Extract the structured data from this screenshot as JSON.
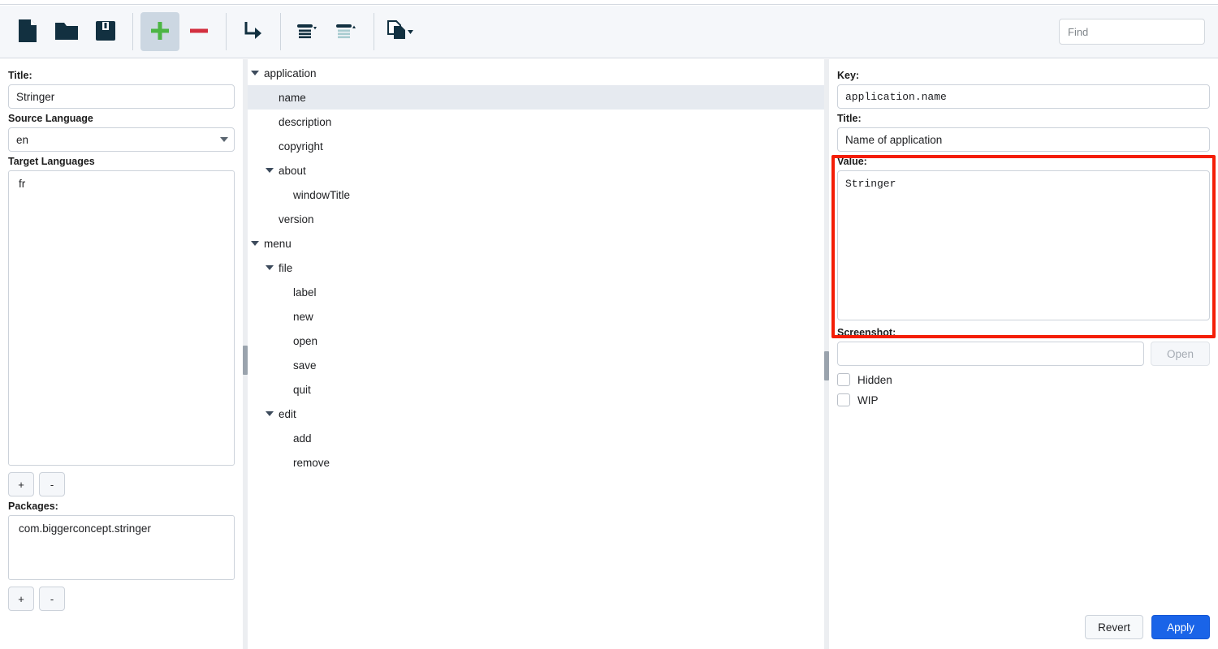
{
  "toolbar": {
    "buttons": [
      {
        "name": "new-file-button",
        "icon": "new-file-icon",
        "label": "New"
      },
      {
        "name": "open-folder-button",
        "icon": "open-folder-icon",
        "label": "Open"
      },
      {
        "name": "save-button",
        "icon": "save-floppy-icon",
        "label": "Save"
      },
      {
        "name": "add-button",
        "icon": "plus-icon",
        "label": "Add"
      },
      {
        "name": "remove-button",
        "icon": "minus-icon",
        "label": "Remove"
      },
      {
        "name": "indent-button",
        "icon": "arrow-turn-right-icon",
        "label": "Indent"
      },
      {
        "name": "collapse-button",
        "icon": "collapse-list-icon",
        "label": "Collapse"
      },
      {
        "name": "expand-button",
        "icon": "expand-list-icon",
        "label": "Expand"
      },
      {
        "name": "duplicate-button",
        "icon": "copy-pages-icon",
        "label": "Duplicate"
      }
    ],
    "find_placeholder": "Find",
    "find_value": ""
  },
  "left": {
    "title_label": "Title:",
    "title_value": "Stringer",
    "source_language_label": "Source Language",
    "source_language_value": "en",
    "target_languages_label": "Target Languages",
    "target_languages": [
      "fr"
    ],
    "target_add_label": "+",
    "target_remove_label": "-",
    "packages_label": "Packages:",
    "packages": [
      "com.biggerconcept.stringer"
    ],
    "packages_add_label": "+",
    "packages_remove_label": "-"
  },
  "tree": {
    "nodes": [
      {
        "label": "application",
        "depth": 0,
        "expandable": true,
        "selected": false
      },
      {
        "label": "name",
        "depth": 1,
        "expandable": false,
        "selected": true
      },
      {
        "label": "description",
        "depth": 1,
        "expandable": false,
        "selected": false
      },
      {
        "label": "copyright",
        "depth": 1,
        "expandable": false,
        "selected": false
      },
      {
        "label": "about",
        "depth": 1,
        "expandable": true,
        "selected": false
      },
      {
        "label": "windowTitle",
        "depth": 2,
        "expandable": false,
        "selected": false
      },
      {
        "label": "version",
        "depth": 1,
        "expandable": false,
        "selected": false
      },
      {
        "label": "menu",
        "depth": 0,
        "expandable": true,
        "selected": false
      },
      {
        "label": "file",
        "depth": 1,
        "expandable": true,
        "selected": false
      },
      {
        "label": "label",
        "depth": 2,
        "expandable": false,
        "selected": false
      },
      {
        "label": "new",
        "depth": 2,
        "expandable": false,
        "selected": false
      },
      {
        "label": "open",
        "depth": 2,
        "expandable": false,
        "selected": false
      },
      {
        "label": "save",
        "depth": 2,
        "expandable": false,
        "selected": false
      },
      {
        "label": "quit",
        "depth": 2,
        "expandable": false,
        "selected": false
      },
      {
        "label": "edit",
        "depth": 1,
        "expandable": true,
        "selected": false
      },
      {
        "label": "add",
        "depth": 2,
        "expandable": false,
        "selected": false
      },
      {
        "label": "remove",
        "depth": 2,
        "expandable": false,
        "selected": false
      }
    ]
  },
  "right": {
    "key_label": "Key:",
    "key_value": "application.name",
    "title_label": "Title:",
    "title_value": "Name of application",
    "value_label": "Value:",
    "value_text": "Stringer",
    "screenshot_label": "Screenshot:",
    "screenshot_value": "",
    "open_label": "Open",
    "hidden_label": "Hidden",
    "hidden_checked": false,
    "wip_label": "WIP",
    "wip_checked": false,
    "revert_label": "Revert",
    "apply_label": "Apply"
  },
  "colors": {
    "highlight_border": "#f41e07",
    "primary_button": "#1a64e8",
    "toolbar_bg": "#f5f7fa",
    "selected_row": "#e6eaf0",
    "icon_dark": "#123040",
    "plus_green": "#4cb544",
    "minus_red": "#d32f3f"
  }
}
